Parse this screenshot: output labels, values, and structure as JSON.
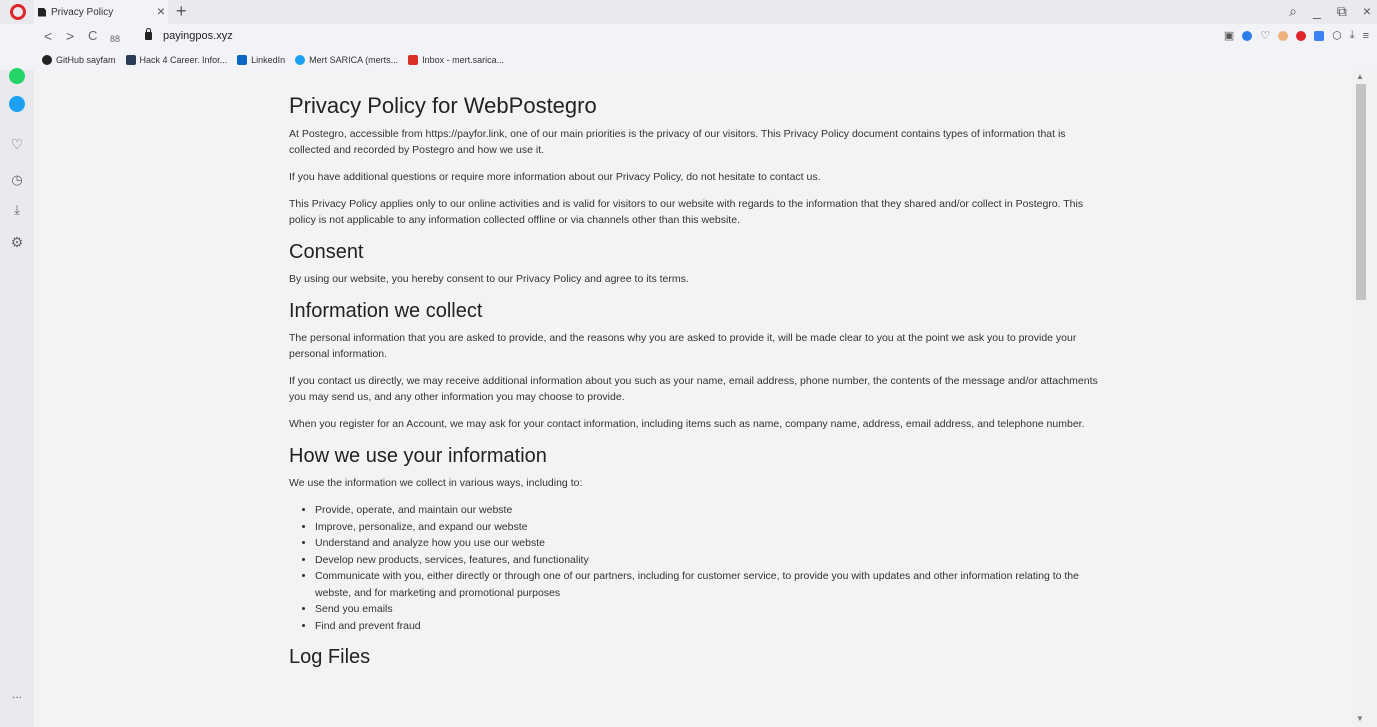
{
  "tab": {
    "title": "Privacy Policy",
    "close": "×",
    "new_tab": "+"
  },
  "window_controls": {
    "search": "⌕",
    "minimize": "_",
    "restore": "⧉",
    "close": "×"
  },
  "nav": {
    "back": "<",
    "forward": ">",
    "reload": "C",
    "speed_dial": "88"
  },
  "url": "payingpos.xyz",
  "bookmarks": [
    {
      "label": "GitHub sayfam",
      "color": "#222222"
    },
    {
      "label": "Hack 4 Career. Infor...",
      "color": "#2b3a55"
    },
    {
      "label": "LinkedIn",
      "color": "#0a66c2"
    },
    {
      "label": "Mert SARICA (merts...",
      "color": "#1da1f2"
    },
    {
      "label": "Inbox - mert.sarica...",
      "color": "#d93025"
    }
  ],
  "sidebar": {
    "more": "..."
  },
  "colors": {
    "opera_red": "#e0242b",
    "whatsapp": "#25d366",
    "twitter": "#1da1f2"
  },
  "page": {
    "title": "Privacy Policy for WebPostegro",
    "intro_p1": "At Postegro, accessible from https://payfor.link, one of our main priorities is the privacy of our visitors. This Privacy Policy document contains types of information that is collected and recorded by Postegro and how we use it.",
    "intro_p2": "If you have additional questions or require more information about our Privacy Policy, do not hesitate to contact us.",
    "intro_p3": "This Privacy Policy applies only to our online activities and is valid for visitors to our website with regards to the information that they shared and/or collect in Postegro. This policy is not applicable to any information collected offline or via channels other than this website.",
    "consent_heading": "Consent",
    "consent_p": "By using our website, you hereby consent to our Privacy Policy and agree to its terms.",
    "collect_heading": "Information we collect",
    "collect_p1": "The personal information that you are asked to provide, and the reasons why you are asked to provide it, will be made clear to you at the point we ask you to provide your personal information.",
    "collect_p2": "If you contact us directly, we may receive additional information about you such as your name, email address, phone number, the contents of the message and/or attachments you may send us, and any other information you may choose to provide.",
    "collect_p3": "When you register for an Account, we may ask for your contact information, including items such as name, company name, address, email address, and telephone number.",
    "use_heading": "How we use your information",
    "use_p": "We use the information we collect in various ways, including to:",
    "use_list": [
      "Provide, operate, and maintain our webste",
      "Improve, personalize, and expand our webste",
      "Understand and analyze how you use our webste",
      "Develop new products, services, features, and functionality",
      "Communicate with you, either directly or through one of our partners, including for customer service, to provide you with updates and other information relating to the webste, and for marketing and promotional purposes",
      "Send you emails",
      "Find and prevent fraud"
    ],
    "next_heading_partial": "Log Files"
  }
}
